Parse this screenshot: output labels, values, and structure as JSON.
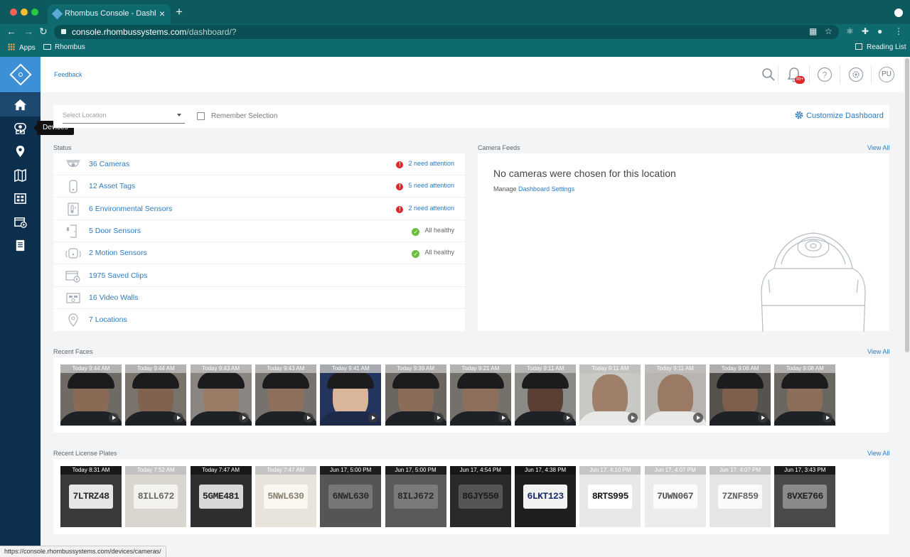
{
  "browser": {
    "tab_title": "Rhombus Console - Dashboard",
    "url_host": "console.rhombussystems.com",
    "url_path": "/dashboard/?",
    "bookmarks": [
      "Apps",
      "Rhombus"
    ],
    "reading_list": "Reading List",
    "status_url": "https://console.rhombussystems.com/devices/cameras/"
  },
  "sidebar": {
    "tooltip": "Devices",
    "items": [
      {
        "icon": "home-icon",
        "active": true
      },
      {
        "icon": "devices-icon",
        "active": false
      },
      {
        "icon": "location-pin-icon",
        "active": false
      },
      {
        "icon": "map-icon",
        "active": false
      },
      {
        "icon": "video-wall-icon",
        "active": false
      },
      {
        "icon": "saved-clips-icon",
        "active": false
      },
      {
        "icon": "reports-icon",
        "active": false
      }
    ]
  },
  "header": {
    "feedback": "Feedback",
    "notification_badge": "99+",
    "avatar_initials": "PU"
  },
  "filters": {
    "location_placeholder": "Select Location",
    "remember_label": "Remember Selection",
    "customize_label": "Customize Dashboard"
  },
  "status": {
    "title": "Status",
    "rows": [
      {
        "icon": "camera-dome-icon",
        "label": "36 Cameras",
        "status": "2 need attention",
        "state": "warn"
      },
      {
        "icon": "asset-tag-icon",
        "label": "12 Asset Tags",
        "status": "5 need attention",
        "state": "warn"
      },
      {
        "icon": "environmental-sensor-icon",
        "label": "6 Environmental Sensors",
        "status": "2 need attention",
        "state": "warn"
      },
      {
        "icon": "door-sensor-icon",
        "label": "5 Door Sensors",
        "status": "All healthy",
        "state": "ok"
      },
      {
        "icon": "motion-sensor-icon",
        "label": "2 Motion Sensors",
        "status": "All healthy",
        "state": "ok"
      },
      {
        "icon": "saved-clips-icon",
        "label": "1975 Saved Clips",
        "status": "",
        "state": "none"
      },
      {
        "icon": "video-wall-icon",
        "label": "16 Video Walls",
        "status": "",
        "state": "none"
      },
      {
        "icon": "location-pin-icon",
        "label": "7 Locations",
        "status": "",
        "state": "none"
      }
    ]
  },
  "camera_feeds": {
    "title": "Camera Feeds",
    "view_all": "View All",
    "empty_message": "No cameras were chosen for this location",
    "manage_prefix": "Manage",
    "manage_link": "Dashboard Settings"
  },
  "recent_faces": {
    "title": "Recent Faces",
    "view_all": "View All",
    "items": [
      {
        "time": "Today 9:44 AM"
      },
      {
        "time": "Today 9:44 AM"
      },
      {
        "time": "Today 9:43 AM"
      },
      {
        "time": "Today 9:43 AM"
      },
      {
        "time": "Today 9:41 AM"
      },
      {
        "time": "Today 9:39 AM"
      },
      {
        "time": "Today 9:21 AM"
      },
      {
        "time": "Today 9:11 AM"
      },
      {
        "time": "Today 9:11 AM"
      },
      {
        "time": "Today 9:11 AM"
      },
      {
        "time": "Today 9:08 AM"
      },
      {
        "time": "Today 9:08 AM"
      }
    ]
  },
  "recent_plates": {
    "title": "Recent License Plates",
    "view_all": "View All",
    "items": [
      {
        "time": "Today 8:31 AM",
        "plate": "7LTRZ48"
      },
      {
        "time": "Today 7:52 AM",
        "plate": "8ILL672"
      },
      {
        "time": "Today 7:47 AM",
        "plate": "5GME481"
      },
      {
        "time": "Today 7:47 AM",
        "plate": "5NWL630"
      },
      {
        "time": "Jun 17, 5:00 PM",
        "plate": "6NWL630"
      },
      {
        "time": "Jun 17, 5:00 PM",
        "plate": "8ILJ672"
      },
      {
        "time": "Jun 17, 4:54 PM",
        "plate": "8GJY550"
      },
      {
        "time": "Jun 17, 4:38 PM",
        "plate": "6LKT123"
      },
      {
        "time": "Jun 17, 4:10 PM",
        "plate": "8RTS995"
      },
      {
        "time": "Jun 17, 4:07 PM",
        "plate": "7UWN067"
      },
      {
        "time": "Jun 17, 4:07 PM",
        "plate": "7ZNF859"
      },
      {
        "time": "Jun 17, 3:43 PM",
        "plate": "8VXE766"
      }
    ]
  }
}
